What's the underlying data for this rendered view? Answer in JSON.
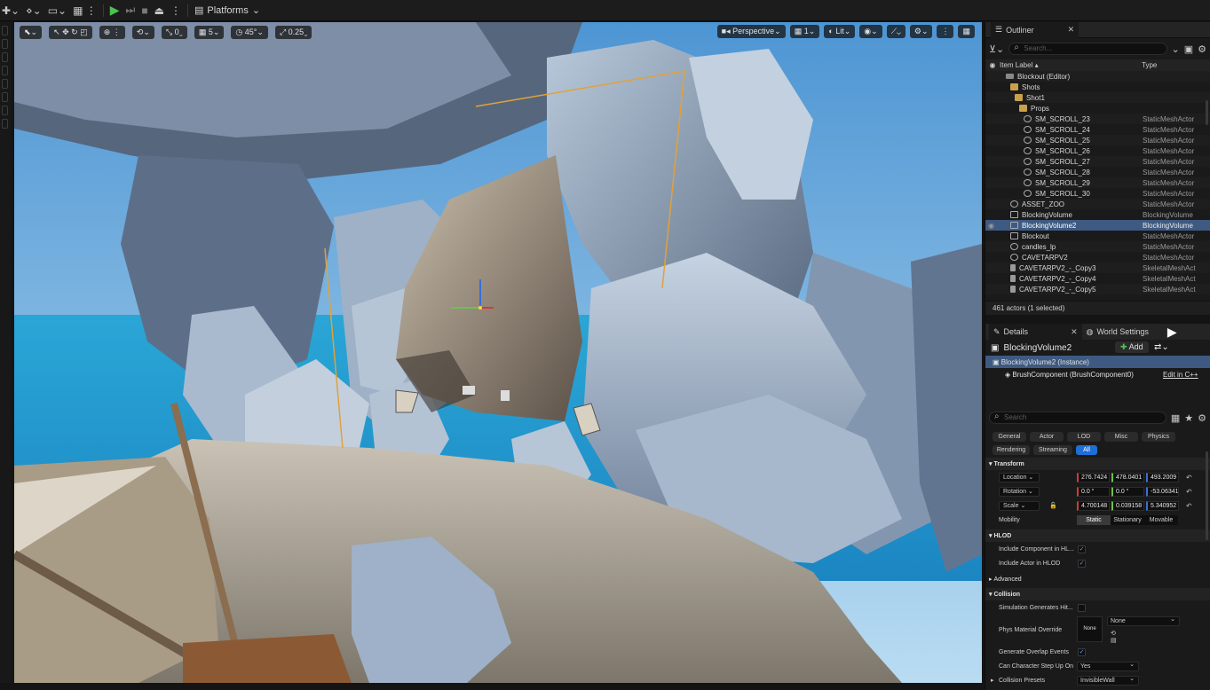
{
  "toolbar": {
    "platforms_label": "Platforms"
  },
  "viewport": {
    "snap_rotate": "0",
    "snap_move": "5",
    "angle": "45°",
    "scale_snap": "0.25",
    "perspective_label": "Perspective",
    "camera_speed": "1",
    "lit_label": "Lit"
  },
  "outliner": {
    "title": "Outliner",
    "search_placeholder": "Search...",
    "col_label": "Item Label",
    "col_type": "Type",
    "rows": [
      {
        "label": "Blockout (Editor)",
        "type": "",
        "indent": 2,
        "icon": "lvl"
      },
      {
        "label": "Shots",
        "type": "",
        "indent": 3,
        "icon": "folder"
      },
      {
        "label": "Shot1",
        "type": "",
        "indent": 4,
        "icon": "folder"
      },
      {
        "label": "Props",
        "type": "",
        "indent": 5,
        "icon": "folder"
      },
      {
        "label": "SM_SCROLL_23",
        "type": "StaticMeshActor",
        "indent": 6,
        "icon": "mesh"
      },
      {
        "label": "SM_SCROLL_24",
        "type": "StaticMeshActor",
        "indent": 6,
        "icon": "mesh"
      },
      {
        "label": "SM_SCROLL_25",
        "type": "StaticMeshActor",
        "indent": 6,
        "icon": "mesh"
      },
      {
        "label": "SM_SCROLL_26",
        "type": "StaticMeshActor",
        "indent": 6,
        "icon": "mesh"
      },
      {
        "label": "SM_SCROLL_27",
        "type": "StaticMeshActor",
        "indent": 6,
        "icon": "mesh"
      },
      {
        "label": "SM_SCROLL_28",
        "type": "StaticMeshActor",
        "indent": 6,
        "icon": "mesh"
      },
      {
        "label": "SM_SCROLL_29",
        "type": "StaticMeshActor",
        "indent": 6,
        "icon": "mesh"
      },
      {
        "label": "SM_SCROLL_30",
        "type": "StaticMeshActor",
        "indent": 6,
        "icon": "mesh"
      },
      {
        "label": "ASSET_ZOO",
        "type": "StaticMeshActor",
        "indent": 3,
        "icon": "mesh"
      },
      {
        "label": "BlockingVolume",
        "type": "BlockingVolume",
        "indent": 3,
        "icon": "vol"
      },
      {
        "label": "BlockingVolume2",
        "type": "BlockingVolume",
        "indent": 3,
        "icon": "vol",
        "selected": true
      },
      {
        "label": "Blockout",
        "type": "StaticMeshActor",
        "indent": 3,
        "icon": "vol"
      },
      {
        "label": "candles_lp",
        "type": "StaticMeshActor",
        "indent": 3,
        "icon": "mesh"
      },
      {
        "label": "CAVETARPV2",
        "type": "StaticMeshActor",
        "indent": 3,
        "icon": "mesh"
      },
      {
        "label": "CAVETARPV2_-_Copy3",
        "type": "SkeletalMeshAct",
        "indent": 3,
        "icon": "skel"
      },
      {
        "label": "CAVETARPV2_-_Copy4",
        "type": "SkeletalMeshAct",
        "indent": 3,
        "icon": "skel"
      },
      {
        "label": "CAVETARPV2_-_Copy5",
        "type": "SkeletalMeshAct",
        "indent": 3,
        "icon": "skel"
      }
    ],
    "actor_count": "461 actors (1 selected)"
  },
  "details": {
    "tab_details": "Details",
    "tab_world": "World Settings",
    "object_name": "BlockingVolume2",
    "add_label": "Add",
    "instance_label": "BlockingVolume2 (Instance)",
    "component_label": "BrushComponent (BrushComponent0)",
    "edit_cpp": "Edit in C++",
    "search_placeholder": "Search",
    "filters": [
      "General",
      "Actor",
      "LOD",
      "Misc",
      "Physics",
      "Rendering",
      "Streaming",
      "All"
    ],
    "transform": {
      "title": "Transform",
      "location_label": "Location",
      "location": [
        "276.7424",
        "478.0401",
        "493.2009"
      ],
      "rotation_label": "Rotation",
      "rotation": [
        "0.0 °",
        "0.0 °",
        "-53.06341"
      ],
      "scale_label": "Scale",
      "scale": [
        "4.700148",
        "0.039158",
        "5.340952"
      ],
      "mobility_label": "Mobility",
      "mobility": [
        "Static",
        "Stationary",
        "Movable"
      ]
    },
    "hlod": {
      "title": "HLOD",
      "include_component": "Include Component in HL...",
      "include_actor": "Include Actor in HLOD"
    },
    "advanced": "Advanced",
    "collision": {
      "title": "Collision",
      "sim_hit": "Simulation Generates Hit...",
      "phys_mat": "Phys Material Override",
      "phys_none_thumb": "None",
      "phys_none": "None",
      "overlap": "Generate Overlap Events",
      "step_up": "Can Character Step Up On",
      "step_up_value": "Yes",
      "presets": "Collision Presets",
      "presets_value": "InvisibleWall"
    }
  },
  "colors": {
    "selection": "#3e5a82",
    "accent_blue": "#1f6fd6",
    "play_green": "#4fc24f"
  }
}
